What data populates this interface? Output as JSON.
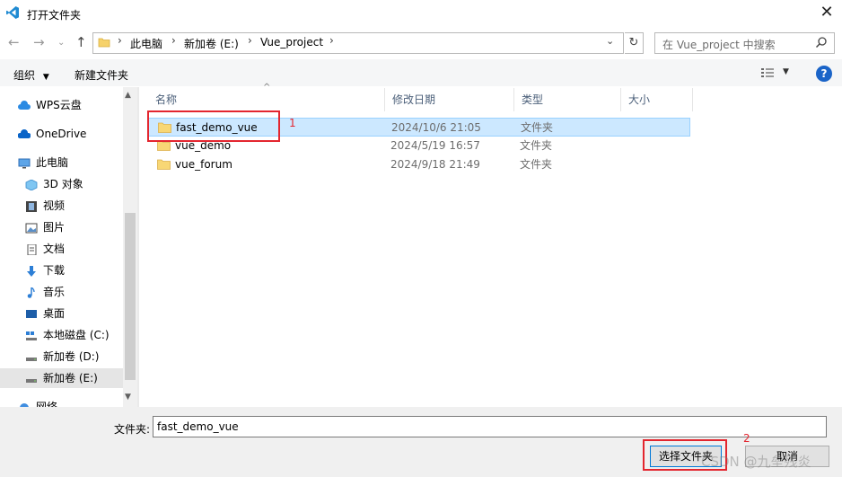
{
  "window": {
    "title": "打开文件夹"
  },
  "address": {
    "breadcrumbs": [
      "此电脑",
      "新加卷 (E:)",
      "Vue_project"
    ],
    "search_placeholder": "在 Vue_project 中搜索"
  },
  "toolbar": {
    "organize": "组织",
    "new_folder": "新建文件夹",
    "help": "?"
  },
  "sidebar": {
    "items": [
      {
        "label": "WPS云盘"
      },
      {
        "label": "OneDrive"
      },
      {
        "label": "此电脑"
      },
      {
        "label": "3D 对象"
      },
      {
        "label": "视频"
      },
      {
        "label": "图片"
      },
      {
        "label": "文档"
      },
      {
        "label": "下载"
      },
      {
        "label": "音乐"
      },
      {
        "label": "桌面"
      },
      {
        "label": "本地磁盘 (C:)"
      },
      {
        "label": "新加卷 (D:)"
      },
      {
        "label": "新加卷 (E:)"
      },
      {
        "label": "网络"
      }
    ]
  },
  "columns": [
    "名称",
    "修改日期",
    "类型",
    "大小"
  ],
  "files": [
    {
      "name": "fast_demo_vue",
      "date": "2024/10/6 21:05",
      "type": "文件夹"
    },
    {
      "name": "vue_demo",
      "date": "2024/5/19 16:57",
      "type": "文件夹"
    },
    {
      "name": "vue_forum",
      "date": "2024/9/18 21:49",
      "type": "文件夹"
    }
  ],
  "bottom": {
    "folder_label": "文件夹:",
    "folder_value": "fast_demo_vue",
    "select_button": "选择文件夹",
    "cancel_button": "取消"
  },
  "annotations": {
    "one": "1",
    "two": "2"
  },
  "watermark": "CSDN @九垒残炎",
  "colors": {
    "selection": "#cce8ff",
    "annotation": "#e3262f",
    "accent": "#0078d7"
  }
}
